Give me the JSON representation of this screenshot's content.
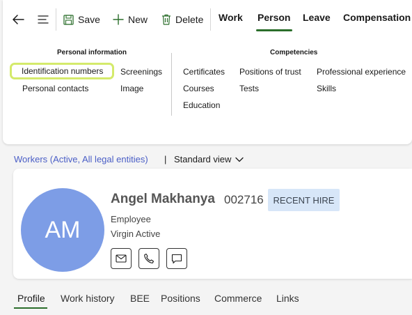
{
  "toolbar": {
    "back_icon": "arrow-left-icon",
    "menu_icon": "hamburger-icon",
    "save_label": "Save",
    "new_label": "New",
    "delete_label": "Delete",
    "tabs": [
      {
        "label": "Work"
      },
      {
        "label": "Person"
      },
      {
        "label": "Leave"
      },
      {
        "label": "Compensation"
      }
    ],
    "active_tab": "Person"
  },
  "menu": {
    "personal_information": {
      "title": "Personal information",
      "items": [
        "Identification numbers",
        "Screenings",
        "Personal contacts",
        "Image"
      ]
    },
    "competencies": {
      "title": "Competencies",
      "items": [
        "Certificates",
        "Positions of trust",
        "Professional experience",
        "Courses",
        "Tests",
        "Skills",
        "Education"
      ]
    }
  },
  "breadcrumb": {
    "link": "Workers (Active, All legal entities)",
    "separator": "|",
    "view": "Standard view"
  },
  "worker": {
    "initials": "AM",
    "name": "Angel Makhanya",
    "id": "002716",
    "badge": "RECENT HIRE",
    "type": "Employee",
    "company": "Virgin Active",
    "avatar_color": "#7d9de6"
  },
  "bottom_tabs": [
    {
      "label": "Profile"
    },
    {
      "label": "Work history"
    },
    {
      "label": "BEE"
    },
    {
      "label": "Positions"
    },
    {
      "label": "Commerce"
    },
    {
      "label": "Links"
    }
  ],
  "active_bottom_tab": "Profile",
  "colors": {
    "accent_green": "#2b6e2b",
    "link_blue": "#4a5ec6",
    "focus_highlight": "#d4ea6b",
    "badge_bg": "#d7e6f8"
  }
}
